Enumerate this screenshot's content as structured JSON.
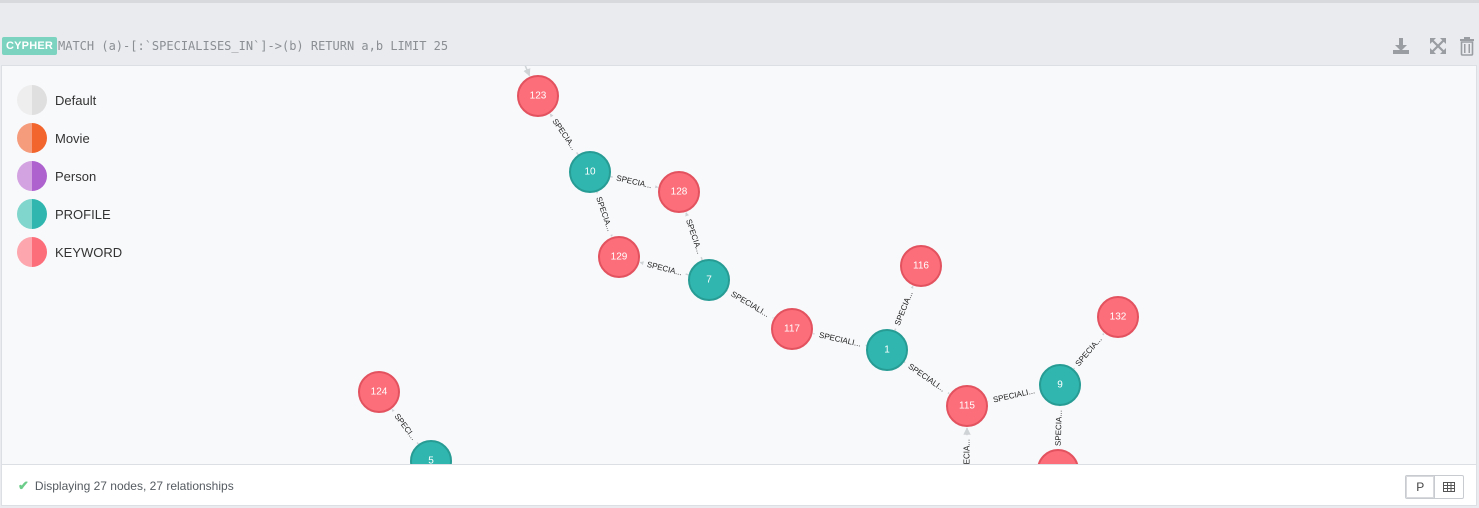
{
  "header": {
    "badge": "CYPHER",
    "query": "MATCH (a)-[:`SPECIALISES_IN`]->(b) RETURN a,b LIMIT 25",
    "download_icon": "download-icon",
    "expand_icon": "expand-icon",
    "delete_icon": "trash-icon"
  },
  "legend": [
    {
      "label": "Default",
      "colors": [
        "#eeeeee",
        "#dfdfdf"
      ]
    },
    {
      "label": "Movie",
      "colors": [
        "#f59c7d",
        "#f2652d"
      ]
    },
    {
      "label": "Person",
      "colors": [
        "#d3a2e1",
        "#ad62ce"
      ]
    },
    {
      "label": "PROFILE",
      "colors": [
        "#80d6cc",
        "#30b6af"
      ]
    },
    {
      "label": "KEYWORD",
      "colors": [
        "#fda6ad",
        "#fc6e7a"
      ]
    }
  ],
  "colors": {
    "profile": "#30b6af",
    "profile_stroke": "#279c95",
    "keyword": "#fc6e7a",
    "keyword_stroke": "#e2535f",
    "edge": "#cfd3d6"
  },
  "graph": {
    "nodes": [
      {
        "id": "123",
        "type": "keyword"
      },
      {
        "id": "10",
        "type": "profile"
      },
      {
        "id": "128",
        "type": "keyword"
      },
      {
        "id": "129",
        "type": "keyword"
      },
      {
        "id": "7",
        "type": "profile"
      },
      {
        "id": "116",
        "type": "keyword"
      },
      {
        "id": "117",
        "type": "keyword"
      },
      {
        "id": "1",
        "type": "profile"
      },
      {
        "id": "132",
        "type": "keyword"
      },
      {
        "id": "9",
        "type": "profile"
      },
      {
        "id": "115",
        "type": "keyword"
      },
      {
        "id": "124",
        "type": "keyword"
      },
      {
        "id": "5",
        "type": "profile"
      },
      {
        "id": "",
        "type": "keyword"
      },
      {
        "id": "",
        "type": "keyword"
      }
    ],
    "edges": [
      {
        "from": "top",
        "to": "123",
        "label": ""
      },
      {
        "from": "10",
        "to": "123",
        "label": "SPECIA..."
      },
      {
        "from": "10",
        "to": "128",
        "label": "SPECIA..."
      },
      {
        "from": "10",
        "to": "129",
        "label": "SPECIA..."
      },
      {
        "from": "7",
        "to": "128",
        "label": "SPECIA..."
      },
      {
        "from": "7",
        "to": "129",
        "label": "SPECIA..."
      },
      {
        "from": "7",
        "to": "117",
        "label": "SPECIALI..."
      },
      {
        "from": "1",
        "to": "117",
        "label": "SPECIALI..."
      },
      {
        "from": "1",
        "to": "116",
        "label": "SPECIA..."
      },
      {
        "from": "1",
        "to": "115",
        "label": "SPECIALI..."
      },
      {
        "from": "9",
        "to": "115",
        "label": "SPECIALI..."
      },
      {
        "from": "9",
        "to": "132",
        "label": "SPECIA..."
      },
      {
        "from": "9",
        "to": "bottom9",
        "label": "SPECIA..."
      },
      {
        "from": "bottom115",
        "to": "115",
        "label": "SPECIA..."
      },
      {
        "from": "5",
        "to": "124",
        "label": "SPECI..."
      }
    ]
  },
  "footer": {
    "status": "Displaying 27 nodes, 27 relationships",
    "check_icon": "check-icon",
    "graph_view_label": "P",
    "table_view_icon": "table-icon"
  }
}
